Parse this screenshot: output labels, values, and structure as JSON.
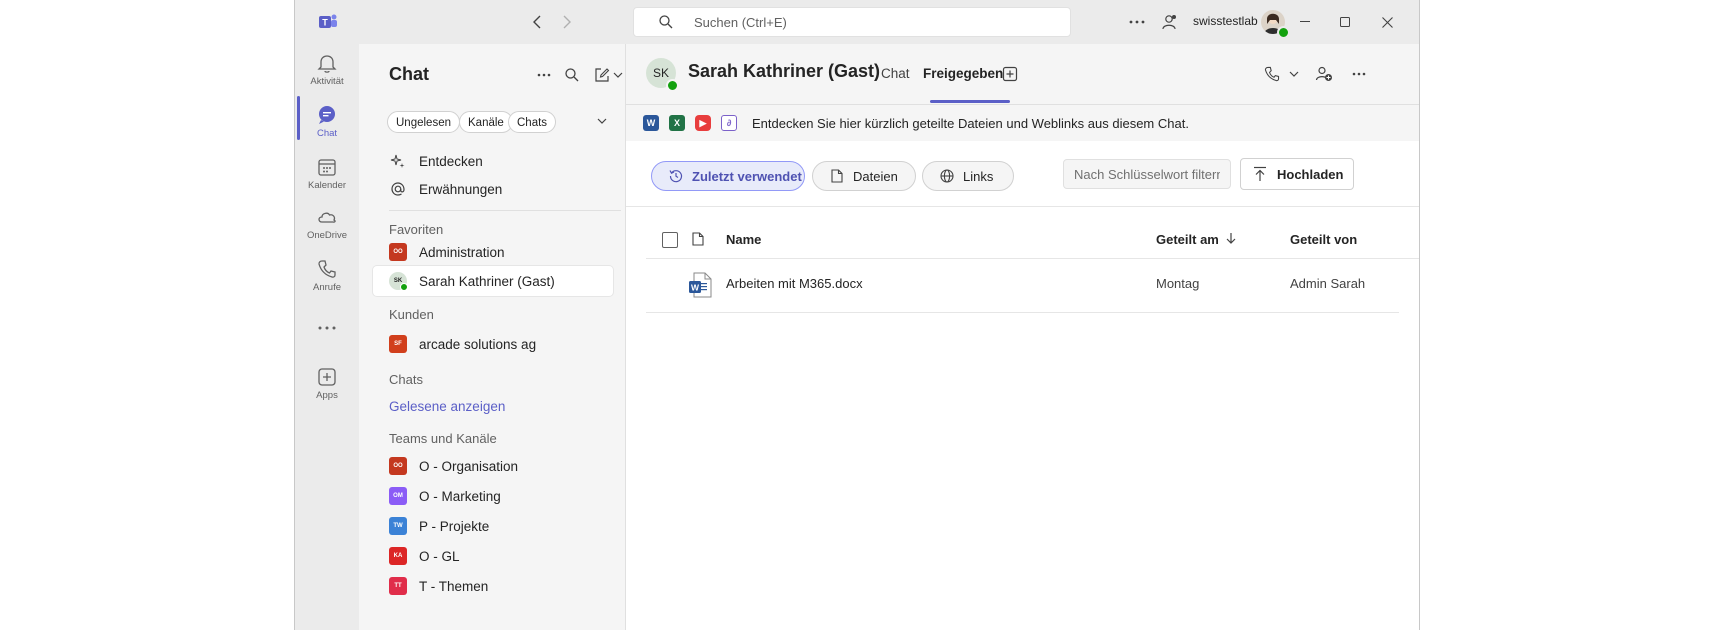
{
  "colors": {
    "accent": "#5b5fc7",
    "presence_green": "#13a10e",
    "word_blue": "#2b579a",
    "excel_green": "#217346"
  },
  "titlebar": {
    "search_placeholder": "Suchen (Ctrl+E)",
    "tenant": "swisstestlab"
  },
  "rail": {
    "items": [
      {
        "label": "Aktivität",
        "icon": "bell-icon"
      },
      {
        "label": "Chat",
        "icon": "chat-icon"
      },
      {
        "label": "Kalender",
        "icon": "calendar-icon"
      },
      {
        "label": "OneDrive",
        "icon": "cloud-icon"
      },
      {
        "label": "Anrufe",
        "icon": "phone-icon"
      },
      {
        "label": "Apps",
        "icon": "plus-square-icon"
      }
    ]
  },
  "panel": {
    "title": "Chat",
    "filters": [
      "Ungelesen",
      "Kanäle",
      "Chats"
    ],
    "top_items": [
      {
        "label": "Entdecken",
        "icon": "sparkle-icon"
      },
      {
        "label": "Erwähnungen",
        "icon": "at-icon"
      }
    ],
    "favorites_label": "Favoriten",
    "favorites": [
      {
        "label": "Administration",
        "initials": "OO",
        "color": "#c4381f"
      },
      {
        "label": "Sarah Kathriner (Gast)",
        "initials": "SK",
        "color": "#d6e3d6"
      }
    ],
    "customers_label": "Kunden",
    "customers": [
      {
        "label": "arcade solutions ag",
        "initials": "SF",
        "color": "#d13f1c"
      }
    ],
    "chats_label": "Chats",
    "show_read": "Gelesene anzeigen",
    "teams_label": "Teams und Kanäle",
    "teams": [
      {
        "label": "O - Organisation",
        "initials": "OO",
        "color": "#c4381f"
      },
      {
        "label": "O - Marketing",
        "initials": "OM",
        "color": "#8b5cf6"
      },
      {
        "label": "P - Projekte",
        "initials": "TW",
        "color": "#3b82d6"
      },
      {
        "label": "O - GL",
        "initials": "KA",
        "color": "#dc2626"
      },
      {
        "label": "T - Themen",
        "initials": "TT",
        "color": "#e02d4a"
      }
    ]
  },
  "main": {
    "avatar_initials": "SK",
    "name": "Sarah Kathriner (Gast)",
    "tabs": [
      "Chat",
      "Freigegeben"
    ],
    "banner": "Entdecken Sie hier kürzlich geteilte Dateien und Weblinks aus diesem Chat.",
    "filters": [
      "Zuletzt verwendet",
      "Dateien",
      "Links"
    ],
    "keyword_placeholder": "Nach Schlüsselwort filtern",
    "upload": "Hochladen",
    "columns": {
      "name": "Name",
      "shared_on": "Geteilt am",
      "shared_by": "Geteilt von"
    },
    "files": [
      {
        "name": "Arbeiten mit M365.docx",
        "shared_on": "Montag",
        "shared_by": "Admin Sarah"
      }
    ]
  }
}
